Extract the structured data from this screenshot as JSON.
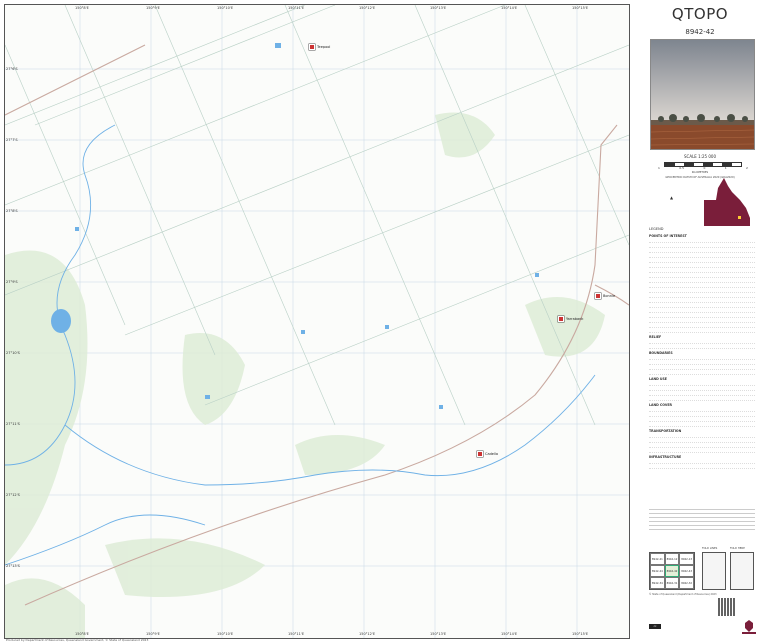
{
  "map": {
    "top_ticks": [
      "150°8'E",
      "150°9'E",
      "150°10'E",
      "150°11'E",
      "150°12'E",
      "150°13'E",
      "150°14'E",
      "150°15'E"
    ],
    "bottom_ticks": [
      "150°8'E",
      "150°9'E",
      "150°10'E",
      "150°11'E",
      "150°12'E",
      "150°13'E",
      "150°14'E",
      "150°15'E"
    ],
    "left_ticks": [
      "27°6'S",
      "27°7'S",
      "27°8'S",
      "27°9'S",
      "27°10'S",
      "27°11'S",
      "27°12'S",
      "27°13'S",
      "27°14'S"
    ],
    "places": [
      {
        "name": "Teepool"
      },
      {
        "name": "Bonnie"
      },
      {
        "name": "Yarrabank"
      },
      {
        "name": "Cadella"
      }
    ],
    "footer_note": "Produced by Department of Resources, Queensland Government, © State of Queensland 2023"
  },
  "sidebar": {
    "title": "QTOPO",
    "sheet_number": "8942-42",
    "scale_label": "SCALE 1:25 000",
    "scale_ticks": [
      "1",
      "0.5",
      "0",
      "1",
      "2"
    ],
    "scale_unit": "KILOMETRES",
    "datum_text": "GEOCENTRIC DATUM OF AUSTRALIA 2020 (GDA2020)",
    "legend_title": "LEGEND",
    "legend_sections": [
      "POINTS OF INTEREST",
      "RELIEF",
      "BOUNDARIES",
      "LAND USE",
      "LAND COVER",
      "TRANSPORTATION",
      "INFRASTRUCTURE"
    ],
    "index_sheets": [
      "8942-41",
      "8942-12",
      "8942-13",
      "8942-44",
      "8942-42",
      "8942-43",
      "8942-34",
      "8942-31",
      "8942-32"
    ],
    "fold_labels": [
      "FOLD LINES",
      "FOLD HERE"
    ],
    "copyright": "© State of Queensland (Department of Resources) 2023"
  },
  "colors": {
    "water": "#6fb1e6",
    "road": "#c9a9a0",
    "track": "#b9c9c0",
    "vegetation": "#cfe3c6",
    "maroon": "#7a1e3a"
  }
}
